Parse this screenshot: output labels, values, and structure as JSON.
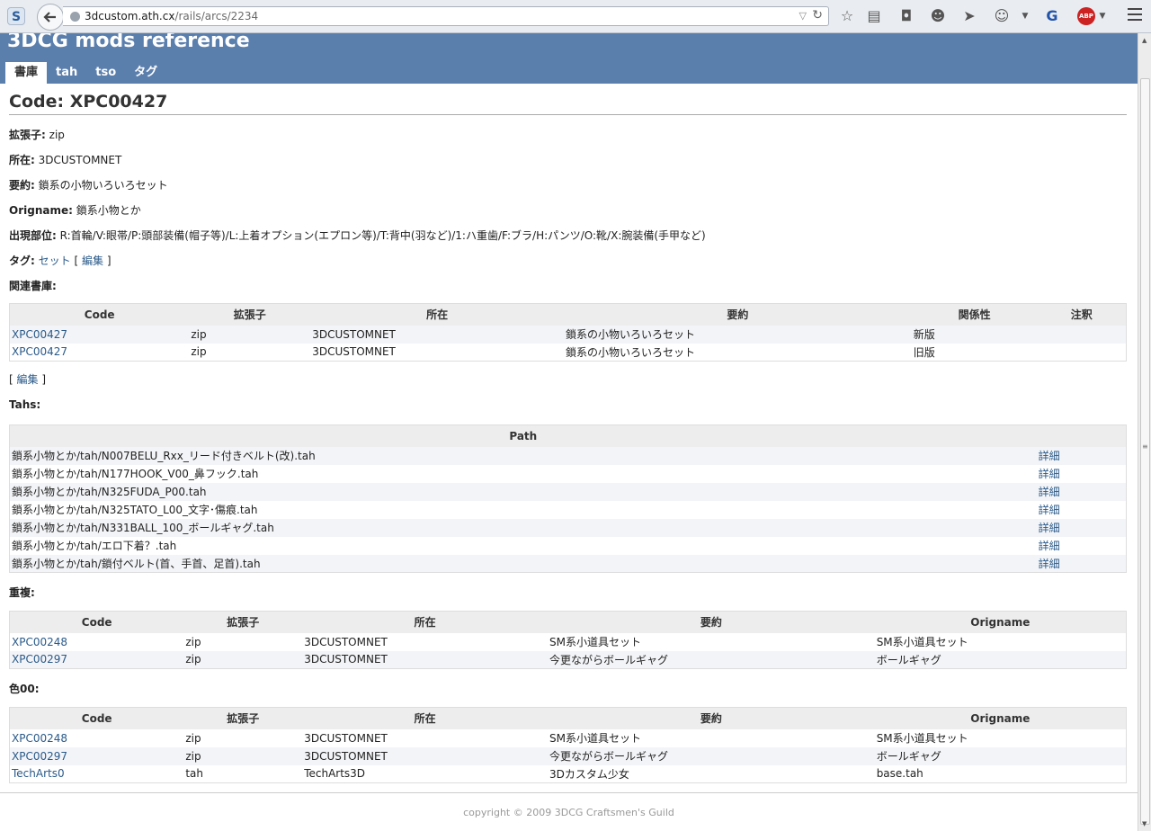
{
  "browser": {
    "url_host": "3dcustom.ath.cx",
    "url_path": "/rails/arcs/2234",
    "logo_letter": "S",
    "abp_label": "ABP"
  },
  "site": {
    "title": "3DCG mods reference",
    "tabs": [
      {
        "label": "書庫",
        "active": true
      },
      {
        "label": "tah",
        "active": false
      },
      {
        "label": "tso",
        "active": false
      },
      {
        "label": "タグ",
        "active": false
      }
    ]
  },
  "arc": {
    "heading": "Code: XPC00427",
    "fields": [
      {
        "label": "拡張子:",
        "value": "zip"
      },
      {
        "label": "所在:",
        "value": "3DCUSTOMNET"
      },
      {
        "label": "要約:",
        "value": "鎖系の小物いろいろセット"
      },
      {
        "label": "Origname:",
        "value": "鎖系小物とか"
      },
      {
        "label": "出現部位:",
        "value": "R:首輪/V:眼帯/P:頭部装備(帽子等)/L:上着オプション(エプロン等)/T:背中(羽など)/1:ハ重歯/F:ブラ/H:パンツ/O:靴/X:腕装備(手甲など)"
      }
    ],
    "tags_label": "タグ:",
    "tag_link": "セット",
    "edit_label": "編集",
    "bracket_open": "[",
    "bracket_close": "]"
  },
  "related": {
    "label": "関連書庫:",
    "headers": [
      "Code",
      "拡張子",
      "所在",
      "要約",
      "関係性",
      "注釈"
    ],
    "rows": [
      [
        "XPC00427",
        "zip",
        "3DCUSTOMNET",
        "鎖系の小物いろいろセット",
        "新版",
        ""
      ],
      [
        "XPC00427",
        "zip",
        "3DCUSTOMNET",
        "鎖系の小物いろいろセット",
        "旧版",
        ""
      ]
    ],
    "edit_label": "編集"
  },
  "tahs": {
    "label": "Tahs:",
    "header": "Path",
    "detail_label": "詳細",
    "rows": [
      "鎖系小物とか/tah/N007BELU_Rxx_リード付きベルト(改).tah",
      "鎖系小物とか/tah/N177HOOK_V00_鼻フック.tah",
      "鎖系小物とか/tah/N325FUDA_P00.tah",
      "鎖系小物とか/tah/N325TATO_L00_文字･傷痕.tah",
      "鎖系小物とか/tah/N331BALL_100_ボールギャグ.tah",
      "鎖系小物とか/tah/エロ下着？.tah",
      "鎖系小物とか/tah/鎖付ベルト(首、手首、足首).tah"
    ]
  },
  "duplicates": {
    "label": "重複:",
    "headers": [
      "Code",
      "拡張子",
      "所在",
      "要約",
      "Origname"
    ],
    "rows": [
      [
        "XPC00248",
        "zip",
        "3DCUSTOMNET",
        "SM系小道具セット",
        "SM系小道具セット"
      ],
      [
        "XPC00297",
        "zip",
        "3DCUSTOMNET",
        "今更ながらボールギャグ",
        "ボールギャグ"
      ]
    ]
  },
  "color00": {
    "label": "色00:",
    "headers": [
      "Code",
      "拡張子",
      "所在",
      "要約",
      "Origname"
    ],
    "rows": [
      [
        "XPC00248",
        "zip",
        "3DCUSTOMNET",
        "SM系小道具セット",
        "SM系小道具セット"
      ],
      [
        "XPC00297",
        "zip",
        "3DCUSTOMNET",
        "今更ながらボールギャグ",
        "ボールギャグ"
      ],
      [
        "TechArts0",
        "tah",
        "TechArts3D",
        "3Dカスタム少女",
        "base.tah"
      ]
    ]
  },
  "footer": {
    "copyright": "copyright © 2009 3DCG Craftsmen's Guild"
  }
}
